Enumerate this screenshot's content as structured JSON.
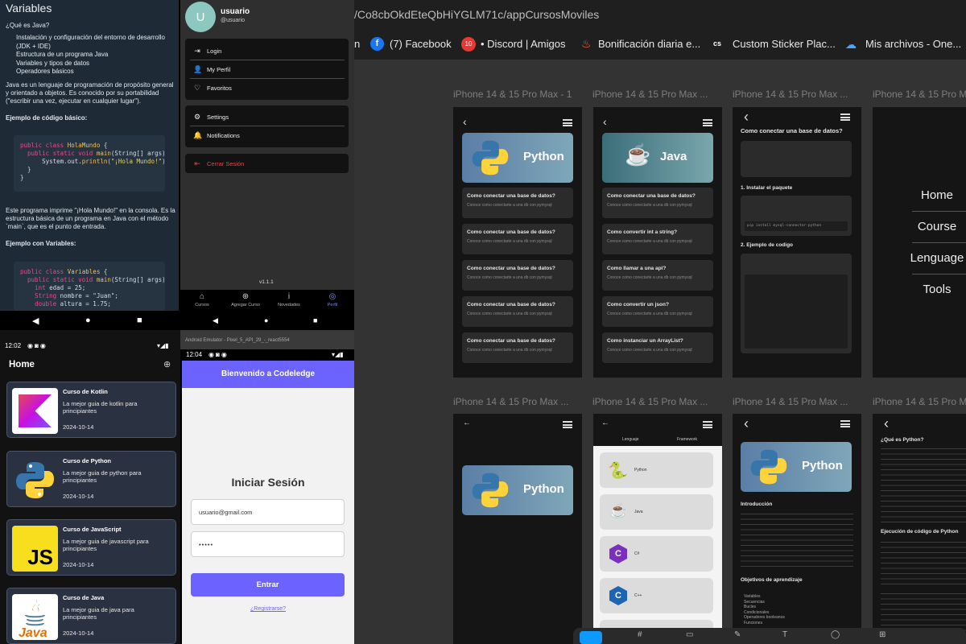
{
  "java_lesson": {
    "title": "Variables",
    "q": "¿Qué es Java?",
    "bullets": [
      "Instalación y configuración del entorno de desarrollo",
      "(JDK + IDE)",
      "Estructura de un programa Java",
      "Variables y tipos de datos",
      "Operadores básicos"
    ],
    "intro": "Java es un lenguaje de programación de propósito general y orientado a objetos. Es conocido por su portabilidad (\"escribir una vez, ejecutar en cualquier lugar\").",
    "example_basic": "Ejemplo de código básico:",
    "code1": {
      "l1_kw": "public class",
      "l1_name": "HolaMundo",
      "l1_end": " {",
      "l2_kw": "public static void",
      "l2_fn": "main",
      "l2_args": "(String[] args) {",
      "l3_pre": "System.out.",
      "l3_fn": "println",
      "l3_str": "(\"¡Hola Mundo!\");",
      "l4": "}",
      "l5": "}"
    },
    "after": "Este programa imprime \"¡Hola Mundo!\" en la consola. Es la estructura básica de un programa en Java con el método `main`, que es el punto de entrada.",
    "example_vars": "Ejemplo con Variables:",
    "code2": {
      "l1_kw": "public class",
      "l1_name": "Variables",
      "l1_end": " {",
      "l2_kw": "public static void",
      "l2_fn": "main",
      "l2_args": "(String[] args) {",
      "l3_kw": "int",
      "l3_rest": " edad = 25;",
      "l4_kw": "String",
      "l4_rest": " nombre = \"Juan\";",
      "l5_kw": "double",
      "l5_rest": " altura = 1.75;"
    }
  },
  "profile": {
    "avatar_letter": "U",
    "username": "usuario",
    "handle": "@usuario",
    "menu1": [
      "Login",
      "My Perfil",
      "Favoritos"
    ],
    "menu2": [
      "Settings",
      "Notifications"
    ],
    "logout": "Cerrar Sesión",
    "version": "v1.1.1",
    "tabs": [
      "Cursos",
      "Agregar Curso",
      "Novedades",
      "Perfil"
    ]
  },
  "emulator_caption": "Android Emulator - Pixel_5_API_29_-_react5554",
  "home": {
    "time": "12:02",
    "title": "Home",
    "courses": [
      {
        "title": "Curso de Kotlin",
        "desc": "La mejor guia de kotlin para principiantes",
        "date": "2024-10-14",
        "logo": "kotlin-logo"
      },
      {
        "title": "Curso de Python",
        "desc": "La mejor guia de python para principiantes",
        "date": "2024-10-14",
        "logo": "python-logo"
      },
      {
        "title": "Curso de JavaScript",
        "desc": "La mejor guia de javascript para principiantes",
        "date": "2024-10-14",
        "logo": "javascript-logo"
      },
      {
        "title": "Curso de Java",
        "desc": "La mejor guia de java para principiantes",
        "date": "2024-10-14",
        "logo": "java-logo"
      }
    ]
  },
  "login": {
    "time": "12:04",
    "header": "Bienvenido a Codeledge",
    "title": "Iniciar Sesión",
    "email": "usuario@gmail.com",
    "password": "•••••",
    "submit": "Entrar",
    "register": "¿Registrarse?"
  },
  "browser": {
    "url": "/Co8cbOkdEteQbHiYGLM71c/appCursosMoviles",
    "bookmarks": [
      "(7) Facebook",
      "• Discord | Amigos",
      "Bonificación diaria e...",
      "Custom Sticker Plac...",
      "Mis archivos - One..."
    ]
  },
  "figma": {
    "row1_labels": [
      "iPhone 14 & 15 Pro Max - 1",
      "iPhone 14 & 15 Pro Max ...",
      "iPhone 14 & 15 Pro Max ...",
      "iPhone 14 & 15 Pro Ma"
    ],
    "row2_labels": [
      "iPhone 14 & 15 Pro Max ...",
      "iPhone 14 & 15 Pro Max ...",
      "iPhone 14 & 15 Pro Max ...",
      "iPhone 14 & 15 Pro Max"
    ],
    "python_banner": "Python",
    "java_banner": "Java",
    "python_cards": [
      "Como conectar una base de datos?",
      "Como conectar una base de datos?",
      "Como conectar una base de datos?",
      "Como conectar una base de datos?",
      "Como conectar una base de datos?"
    ],
    "java_cards": [
      "Como conectar una base de datos?",
      "Como convertir int a string?",
      "Como llamar a una api?",
      "Como convertir un json?",
      "Como instanciar un ArrayList?"
    ],
    "card_desc": "Conoce como conectarte a una db con pymysql",
    "article": {
      "title": "Como conectar una base de datos?",
      "s1": "1. Instalar el paquete",
      "s2": "2. Ejemplo de codigo",
      "cmd": "pip install mysql-connector-python"
    },
    "nav": [
      "Home",
      "Course",
      "Lenguage",
      "Tools"
    ],
    "tabs": [
      "Lenguaje",
      "Framework"
    ],
    "lang_items": [
      "Python",
      "Java",
      "C#",
      "C++"
    ],
    "detail": {
      "intro": "Introducción",
      "objetivos": "Objetivos de aprendizaje",
      "obj_items": [
        "Variables",
        "Secuencias",
        "Bucles",
        "Condicionales",
        "Operadores booleanos",
        "Funciones"
      ]
    },
    "q_python": "¿Qué es Python?",
    "exec_title": "Ejecución de código de Python"
  }
}
